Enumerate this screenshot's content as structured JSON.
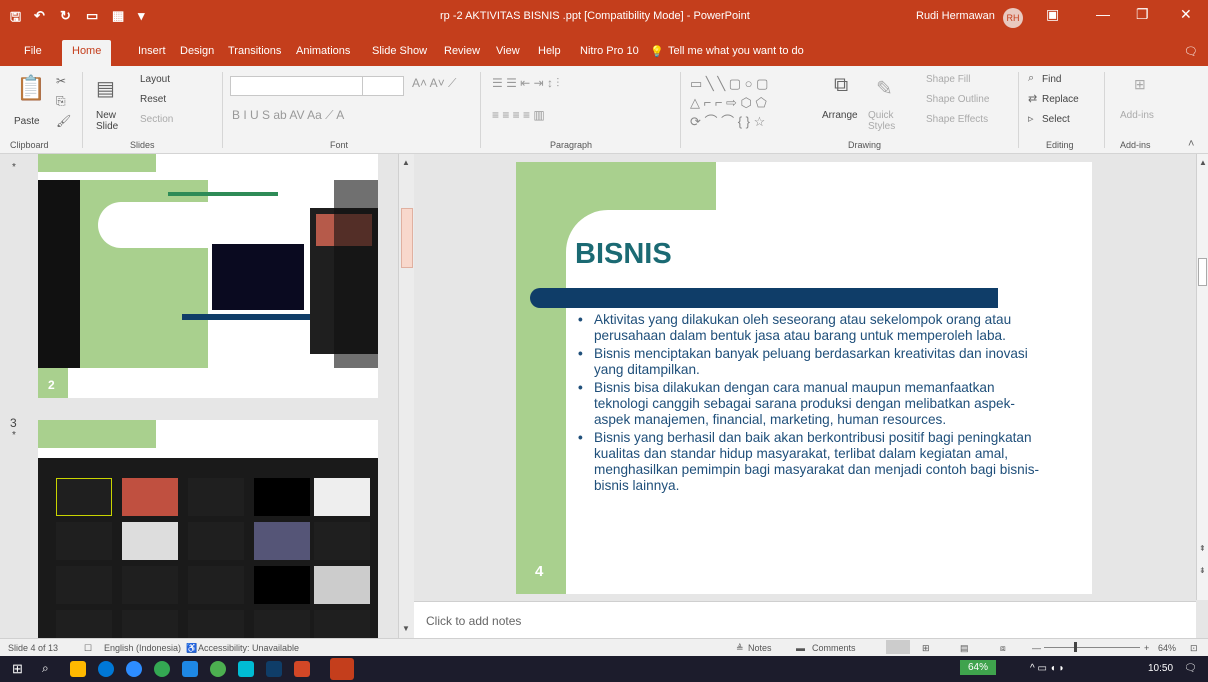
{
  "window": {
    "title": "rp -2 AKTIVITAS BISNIS .ppt [Compatibility Mode] - PowerPoint",
    "user_name": "Rudi Hermawan",
    "user_initials": "RH",
    "minimize": "—",
    "restore": "❐",
    "close": "✕"
  },
  "tabs": [
    "File",
    "Home",
    "Insert",
    "Design",
    "Transitions",
    "Animations",
    "Slide Show",
    "Review",
    "View",
    "Help",
    "Nitro Pro 10"
  ],
  "tell_me": "Tell me what you want to do",
  "ribbon": {
    "clipboard": {
      "paste": "Paste",
      "label": "Clipboard"
    },
    "slides": {
      "new_slide": "New Slide",
      "layout": "Layout",
      "reset": "Reset",
      "section": "Section",
      "label": "Slides"
    },
    "font": {
      "label": "Font"
    },
    "paragraph": {
      "label": "Paragraph"
    },
    "drawing": {
      "arrange": "Arrange",
      "quick_styles": "Quick Styles",
      "shape_fill": "Shape Fill",
      "shape_outline": "Shape Outline",
      "shape_effects": "Shape Effects",
      "label": "Drawing"
    },
    "editing": {
      "find": "Find",
      "replace": "Replace",
      "select": "Select",
      "label": "Editing"
    },
    "addins": {
      "btn": "Add-ins",
      "label": "Add-ins"
    }
  },
  "thumbnails": [
    {
      "number": "2"
    },
    {
      "number": "3"
    }
  ],
  "slide": {
    "title": "BISNIS",
    "number": "4",
    "bullets": [
      "Aktivitas yang dilakukan oleh seseorang atau sekelompok orang atau perusahaan dalam bentuk jasa atau barang untuk memperoleh laba.",
      "Bisnis menciptakan banyak peluang berdasarkan kreativitas dan inovasi yang ditampilkan.",
      "Bisnis bisa dilakukan dengan cara manual maupun memanfaatkan teknologi canggih sebagai sarana produksi dengan melibatkan aspek-aspek manajemen, financial, marketing, human resources.",
      "Bisnis yang berhasil dan baik akan berkontribusi positif bagi peningkatan kualitas dan standar hidup masyarakat, terlibat dalam kegiatan amal, menghasilkan pemimpin bagi masyarakat dan menjadi contoh bagi bisnis-bisnis lainnya."
    ]
  },
  "notes_placeholder": "Click to add notes",
  "status": {
    "slide_count": "Slide 4 of 13",
    "language": "English (Indonesia)",
    "accessibility": "Accessibility: Unavailable",
    "notes": "Notes",
    "comments": "Comments",
    "zoom": "64%"
  },
  "taskbar": {
    "battery": "64%",
    "time": "10:50"
  },
  "colors": {
    "accent": "#c43e1c",
    "slide_green": "#a9d08e",
    "slide_navy": "#0f3d68",
    "title_teal": "#1b6a73"
  }
}
